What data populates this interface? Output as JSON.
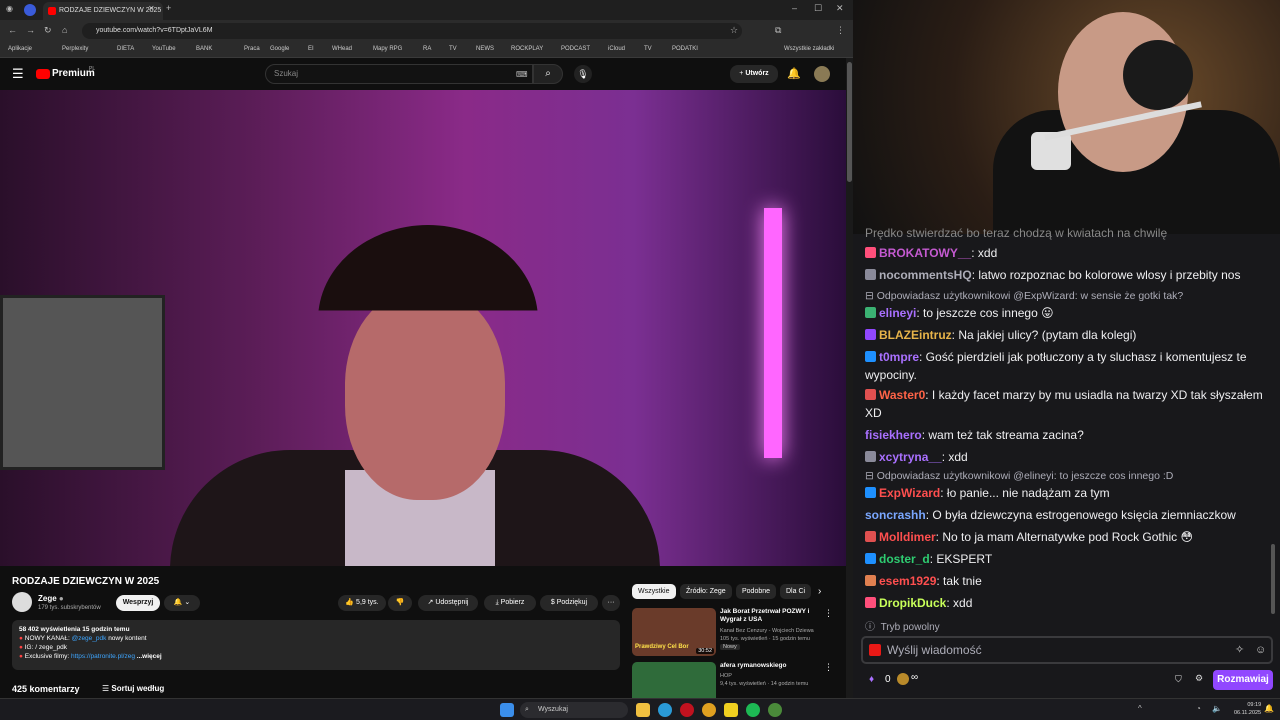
{
  "browser": {
    "tab_title": "RODZAJE DZIEWCZYN W 2025",
    "url": "youtube.com/watch?v=6TDptJaVL6M",
    "bookmarks": [
      "Aplikacje",
      "Perplexity",
      "DIETA",
      "YouTube",
      "BANK",
      "Praca",
      "Google",
      "EI",
      "WHead",
      "Mapy RPG",
      "RA",
      "TV",
      "NEWS",
      "ROCKPLAY",
      "PODCAST",
      "iCloud",
      "TV",
      "PODATKI"
    ],
    "all_bookmarks": "Wszystkie zakładki"
  },
  "youtube": {
    "logo": "Premium",
    "logo_sup": "PL",
    "search_placeholder": "Szukaj",
    "create_label": "Utwórz",
    "video_title": "RODZAJE DZIEWCZYN W 2025",
    "channel_name": "Zege",
    "subscribers": "179 tys. subskrybentów",
    "support_label": "Wesprzyj",
    "likes": "5,9 tys.",
    "share_label": "Udostępnij",
    "download_label": "Pobierz",
    "thanks_label": "Podziękuj",
    "more_label": "···",
    "description": {
      "stats": "58 402 wyświetlenia  15 godzin temu",
      "line1_prefix": "NOWY KANAŁ: ",
      "line1_link": "@zege_pdk",
      "line1_suffix": " nowy kontent",
      "line2": "IG:  / zege_pdk",
      "line3_prefix": "Exclusive filmy: ",
      "line3_link": "https://patronite.pl/zeg",
      "more": "...więcej"
    },
    "comments_count": "425 komentarzy",
    "sort_label": "Sortuj według",
    "chips": [
      "Wszystkie",
      "Źródło: Zege",
      "Podobne",
      "Dla Ci"
    ],
    "recommendations": [
      {
        "title": "Jak Borat Przetrwał POZWY i Wygrał z USA",
        "channel": "Kanał Bez Cenzury - Wojciech Dziewa",
        "meta": "105 tys. wyświetleń · 15 godzin temu",
        "badge": "Nowy",
        "duration": "30:52",
        "thumb_text": "Prawdziwy Cel Bor"
      },
      {
        "title": "afera rymanowskiego",
        "channel": "HOP",
        "meta": "9,4 tys. wyświetleń · 14 godzin temu",
        "badge": "",
        "duration": "",
        "thumb_text": ""
      }
    ]
  },
  "chat": {
    "truncated_top": "Prędko stwierdzać bo teraz chodzą w kwiatach na chwilę",
    "messages": [
      {
        "user": "BROKATOWY__",
        "color": "#c45ad1",
        "text": ": xdd",
        "badge": "#ff4f7b"
      },
      {
        "user": "nocommentsHQ",
        "color": "#adadb8",
        "text": ": latwo rozpoznac bo kolorowe wlosy i przebity nos",
        "badge": "#8a8a9a"
      },
      {
        "reply": "Odpowiadasz użytkownikowi @ExpWizard: w sensie że gotki tak?"
      },
      {
        "user": "elineyi",
        "color": "#a970ff",
        "text": ": to jeszcze cos innego  😛",
        "badge": "#3bb273"
      },
      {
        "user": "BLAZEintruz",
        "color": "#e8b44a",
        "text": ": Na jakiej ulicy? (pytam dla kolegi)",
        "badge": "#9147ff"
      },
      {
        "user": "t0mpre",
        "color": "#a970ff",
        "text": ": Gość pierdzieli jak potłuczony a ty sluchasz i komentujesz te wypociny.",
        "badge": "#1e90ff"
      },
      {
        "user": "Waster0",
        "color": "#ff6347",
        "text": ": I każdy facet marzy by mu usiadla na twarzy XD tak słyszałem XD",
        "badge": "#e05050"
      },
      {
        "user": "fisiekhero",
        "color": "#a970ff",
        "text": ": wam też tak streama zacina?",
        "badge": ""
      },
      {
        "user": "xcytryna__",
        "color": "#a970ff",
        "text": ": xdd",
        "badge": "#8a8a9a"
      },
      {
        "reply": "Odpowiadasz użytkownikowi @elineyi: to jeszcze cos innego :D"
      },
      {
        "user": "ExpWizard",
        "color": "#ff4f4f",
        "text": ": ło panie... nie nadążam za tym",
        "badge": "#1e90ff"
      },
      {
        "user": "soncrashh",
        "color": "#7aa7ff",
        "text": ": O była dziewczyna estrogenowego księcia ziemniaczkow",
        "badge": ""
      },
      {
        "user": "Molldimer",
        "color": "#ff4f4f",
        "text": ": No to ja mam Alternatywke pod Rock Gothic 😳",
        "badge": "#e05050"
      },
      {
        "user": "doster_d",
        "color": "#2ecc71",
        "text": ": EKSPERT",
        "badge": "#1e90ff"
      },
      {
        "user": "esem1929",
        "color": "#ff4f4f",
        "text": ": tak tnie",
        "badge": "#e08050"
      },
      {
        "user": "DropikDuck",
        "color": "#c8ff5a",
        "text": ": xdd",
        "badge": "#ff4f7b"
      }
    ],
    "slow_mode": "Tryb powolny",
    "input_placeholder": "Wyślij wiadomość",
    "points": "0",
    "send_label": "Rozmawiaj"
  },
  "taskbar": {
    "search_placeholder": "Wyszukaj",
    "time": "09:19",
    "date": "06.11.2025"
  }
}
